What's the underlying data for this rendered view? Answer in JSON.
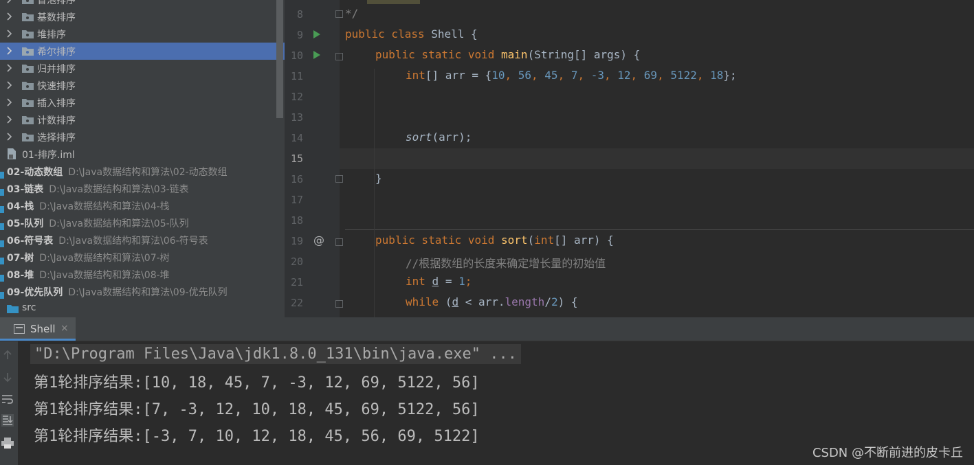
{
  "project_tree": {
    "folders": [
      "冒泡排序",
      "基数排序",
      "堆排序",
      "希尔排序",
      "归并排序",
      "快速排序",
      "插入排序",
      "计数排序",
      "选择排序"
    ],
    "selected": "希尔排序",
    "iml_file": "01-排序.iml",
    "modules": [
      {
        "name": "02-动态数组",
        "path": "D:\\Java数据结构和算法\\02-动态数组"
      },
      {
        "name": "03-链表",
        "path": "D:\\Java数据结构和算法\\03-链表"
      },
      {
        "name": "04-栈",
        "path": "D:\\Java数据结构和算法\\04-栈"
      },
      {
        "name": "05-队列",
        "path": "D:\\Java数据结构和算法\\05-队列"
      },
      {
        "name": "06-符号表",
        "path": "D:\\Java数据结构和算法\\06-符号表"
      },
      {
        "name": "07-树",
        "path": "D:\\Java数据结构和算法\\07-树"
      },
      {
        "name": "08-堆",
        "path": "D:\\Java数据结构和算法\\08-堆"
      },
      {
        "name": "09-优先队列",
        "path": "D:\\Java数据结构和算法\\09-优先队列"
      }
    ],
    "src_label": "src"
  },
  "editor": {
    "line_numbers": [
      "8",
      "9",
      "10",
      "11",
      "12",
      "13",
      "14",
      "15",
      "16",
      "17",
      "18",
      "19",
      "20",
      "21",
      "22"
    ],
    "current_line": "15",
    "code": {
      "l8": "*/",
      "l9_kw": "public class",
      "l9_rest": " Shell {",
      "l10_kw": "public static void",
      "l10_fn": "main",
      "l10_rest": "(String[] args) {",
      "l11_kw": "int",
      "l11_decl": "[] arr = {",
      "l11_values": [
        "10",
        "56",
        "45",
        "7",
        "-3",
        "12",
        "69",
        "5122",
        "18"
      ],
      "l11_end": "};",
      "l14_call": "sort",
      "l14_rest": "(arr);",
      "l16": "}",
      "l19_kw": "public static void",
      "l19_fn": "sort",
      "l19_p1": "(",
      "l19_kw2": "int",
      "l19_p2": "[] arr) {",
      "l20_comment": "//根据数组的长度来确定增长量的初始值",
      "l21_kw": "int",
      "l21_var": "d",
      "l21_eq": " = ",
      "l21_val": "1",
      "l22_kw": "while",
      "l22_p1": " (",
      "l22_var": "d",
      "l22_p2": " < arr.",
      "l22_field": "length",
      "l22_p3": "/",
      "l22_num": "2",
      "l22_p4": ") {"
    }
  },
  "console": {
    "tab_label": "Shell",
    "command": "\"D:\\Program Files\\Java\\jdk1.8.0_131\\bin\\java.exe\" ...",
    "output": [
      "第1轮排序结果:[10, 18, 45, 7, -3, 12, 69, 5122, 56]",
      "第1轮排序结果:[7, -3, 12, 10, 18, 45, 69, 5122, 56]",
      "第1轮排序结果:[-3, 7, 10, 12, 18, 45, 56, 69, 5122]"
    ]
  },
  "watermark": "CSDN @不断前进的皮卡丘",
  "colors": {
    "keyword": "#cc7832",
    "number": "#6897bb",
    "function": "#ffc66d",
    "selection": "#4b6eaf",
    "run_icon": "#499c54"
  }
}
